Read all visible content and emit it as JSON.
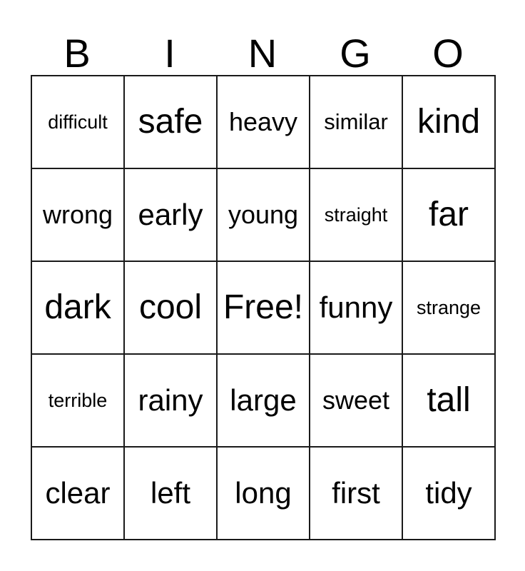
{
  "card": {
    "type": "bingo-card",
    "header_letters": [
      "B",
      "I",
      "N",
      "G",
      "O"
    ],
    "columns": 5,
    "rows": 5,
    "free_space": "Free!",
    "free_space_position": {
      "row": 3,
      "column": 3
    },
    "colors": {
      "background": "#ffffff",
      "text": "#000000",
      "grid_line": "#1a1a1a"
    },
    "grid": [
      [
        {
          "word": "difficult",
          "size": "xs"
        },
        {
          "word": "safe",
          "size": "xl"
        },
        {
          "word": "heavy",
          "size": "m"
        },
        {
          "word": "similar",
          "size": "s"
        },
        {
          "word": "kind",
          "size": "xl"
        }
      ],
      [
        {
          "word": "wrong",
          "size": "m"
        },
        {
          "word": "early",
          "size": "l"
        },
        {
          "word": "young",
          "size": "m"
        },
        {
          "word": "straight",
          "size": "xs"
        },
        {
          "word": "far",
          "size": "xl"
        }
      ],
      [
        {
          "word": "dark",
          "size": "xl"
        },
        {
          "word": "cool",
          "size": "xl"
        },
        {
          "word": "Free!",
          "size": "xl"
        },
        {
          "word": "funny",
          "size": "l"
        },
        {
          "word": "strange",
          "size": "xs"
        }
      ],
      [
        {
          "word": "terrible",
          "size": "xs"
        },
        {
          "word": "rainy",
          "size": "l"
        },
        {
          "word": "large",
          "size": "l"
        },
        {
          "word": "sweet",
          "size": "m"
        },
        {
          "word": "tall",
          "size": "xl"
        }
      ],
      [
        {
          "word": "clear",
          "size": "l"
        },
        {
          "word": "left",
          "size": "l"
        },
        {
          "word": "long",
          "size": "l"
        },
        {
          "word": "first",
          "size": "l"
        },
        {
          "word": "tidy",
          "size": "l"
        }
      ]
    ]
  }
}
